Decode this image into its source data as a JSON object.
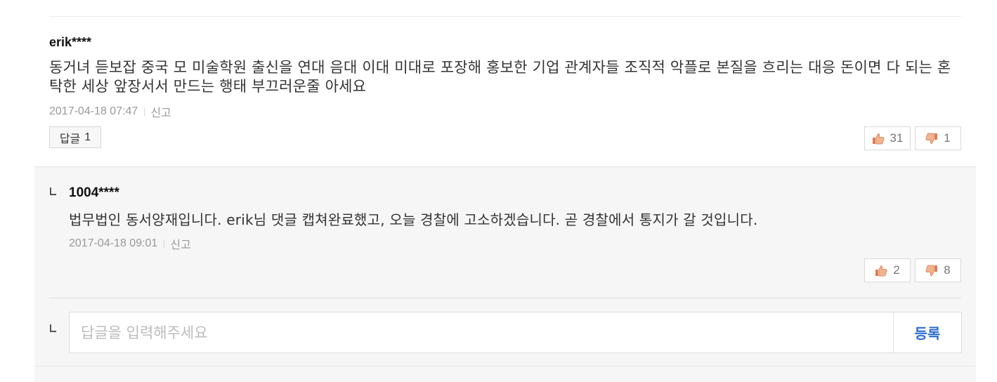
{
  "comment": {
    "author": "erik****",
    "body": "동거녀 듣보잡 중국 모 미술학원 출신을 연대 음대 이대 미대로 포장해 홍보한 기업 관계자들 조직적 악플로 본질을 흐리는 대응 돈이면 다 되는 혼탁한 세상 앞장서서 만드는 행태 부끄러운줄 아세요",
    "date": "2017-04-18 07:47",
    "report_label": "신고",
    "reply_label": "답글",
    "reply_count": "1",
    "likes": "31",
    "dislikes": "1"
  },
  "reply": {
    "author": "1004****",
    "body": "법무법인 동서양재입니다. erik님 댓글 캡쳐완료했고, 오늘 경찰에 고소하겠습니다. 곧 경찰에서 통지가 갈 것입니다.",
    "date": "2017-04-18 09:01",
    "report_label": "신고",
    "likes": "2",
    "dislikes": "8"
  },
  "reply_form": {
    "placeholder": "답글을 입력해주세요",
    "submit_label": "등록"
  },
  "icons": {
    "like": "thumbs-up-icon",
    "dislike": "thumbs-down-icon",
    "reply_corner": "reply-corner-icon"
  },
  "colors": {
    "accent": "#2c6bcf",
    "thumb": "#e07a52",
    "reply_bg": "#f6f6f6"
  }
}
